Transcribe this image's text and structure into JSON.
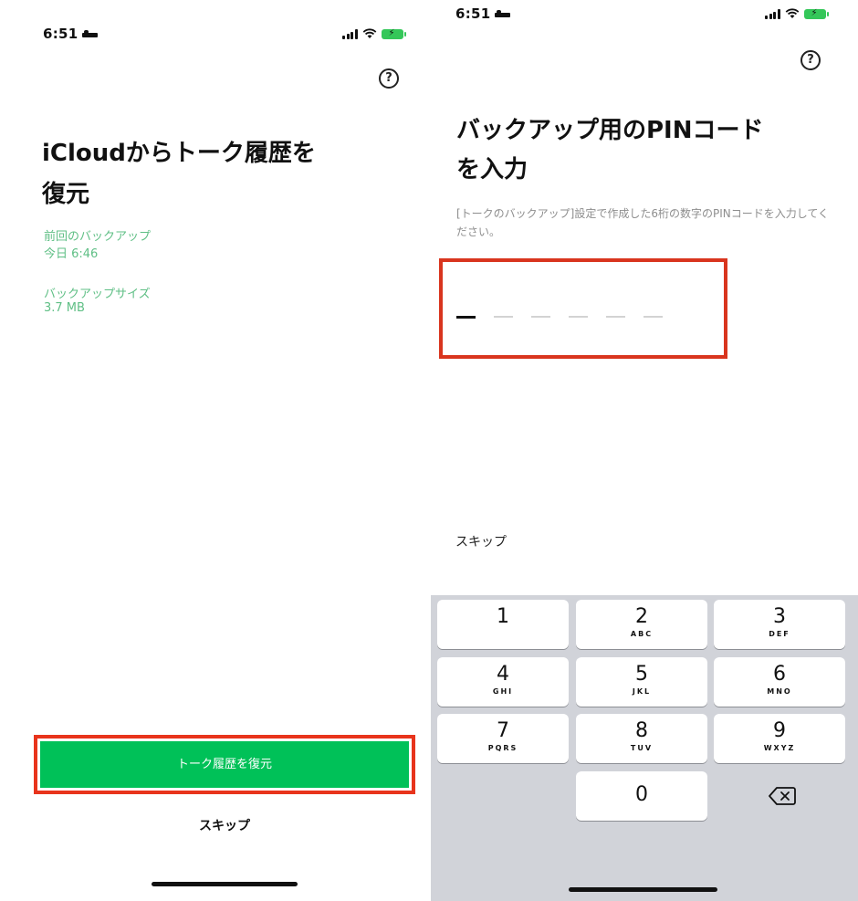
{
  "left_screen": {
    "status": {
      "time": "6:51"
    },
    "help_symbol": "?",
    "title_line1": "iCloudからトーク履歴を",
    "title_line2": "復元",
    "last_backup_label": "前回のバックアップ",
    "last_backup_value": "今日 6:46",
    "backup_size_label": "バックアップサイズ",
    "backup_size_value": "3.7 MB",
    "restore_button": "トーク履歴を復元",
    "skip": "スキップ"
  },
  "right_screen": {
    "status": {
      "time": "6:51"
    },
    "help_symbol": "?",
    "title_line1": "バックアップ用のPINコード",
    "title_line2": "を入力",
    "description": "[トークのバックアップ]設定で作成した6桁の数字のPINコードを入力してください。",
    "pin_length": 6,
    "pin_entered": 0,
    "skip": "スキップ",
    "keypad": {
      "keys": [
        {
          "num": "1",
          "letters": ""
        },
        {
          "num": "2",
          "letters": "ABC"
        },
        {
          "num": "3",
          "letters": "DEF"
        },
        {
          "num": "4",
          "letters": "GHI"
        },
        {
          "num": "5",
          "letters": "JKL"
        },
        {
          "num": "6",
          "letters": "MNO"
        },
        {
          "num": "7",
          "letters": "PQRS"
        },
        {
          "num": "8",
          "letters": "TUV"
        },
        {
          "num": "9",
          "letters": "WXYZ"
        },
        {
          "num": "0",
          "letters": ""
        }
      ],
      "delete_icon": "backspace-icon"
    }
  },
  "colors": {
    "accent_green": "#00c158",
    "info_green": "#5fbf85",
    "highlight_red": "#e8341c",
    "keypad_bg": "#d1d3d9"
  }
}
